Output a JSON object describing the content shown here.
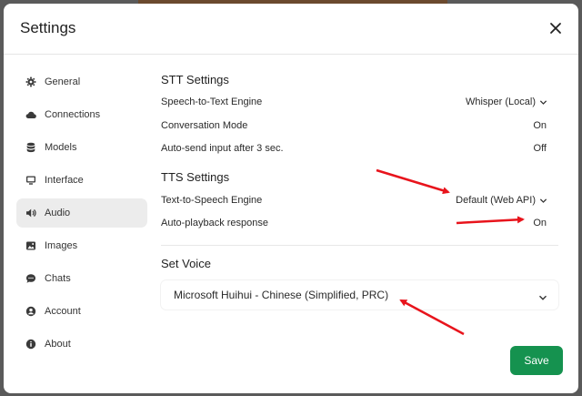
{
  "dialog": {
    "title": "Settings"
  },
  "sidebar": {
    "items": [
      {
        "label": "General",
        "icon": "gear-icon"
      },
      {
        "label": "Connections",
        "icon": "cloud-icon"
      },
      {
        "label": "Models",
        "icon": "database-icon"
      },
      {
        "label": "Interface",
        "icon": "monitor-icon"
      },
      {
        "label": "Audio",
        "icon": "speaker-icon",
        "active": true
      },
      {
        "label": "Images",
        "icon": "image-icon"
      },
      {
        "label": "Chats",
        "icon": "chat-bubble-icon"
      },
      {
        "label": "Account",
        "icon": "user-circle-icon"
      },
      {
        "label": "About",
        "icon": "info-icon"
      }
    ]
  },
  "stt": {
    "title": "STT Settings",
    "engine_label": "Speech-to-Text Engine",
    "engine_value": "Whisper (Local)",
    "conversation_label": "Conversation Mode",
    "conversation_value": "On",
    "autosend_label": "Auto-send input after 3 sec.",
    "autosend_value": "Off"
  },
  "tts": {
    "title": "TTS Settings",
    "engine_label": "Text-to-Speech Engine",
    "engine_value": "Default (Web API)",
    "autoplay_label": "Auto-playback response",
    "autoplay_value": "On"
  },
  "voice": {
    "title": "Set Voice",
    "selected": "Microsoft Huihui - Chinese (Simplified, PRC)"
  },
  "footer": {
    "save_label": "Save"
  },
  "colors": {
    "accent": "#15924f",
    "annotation": "#e8141c",
    "active_nav": "#ececec"
  }
}
